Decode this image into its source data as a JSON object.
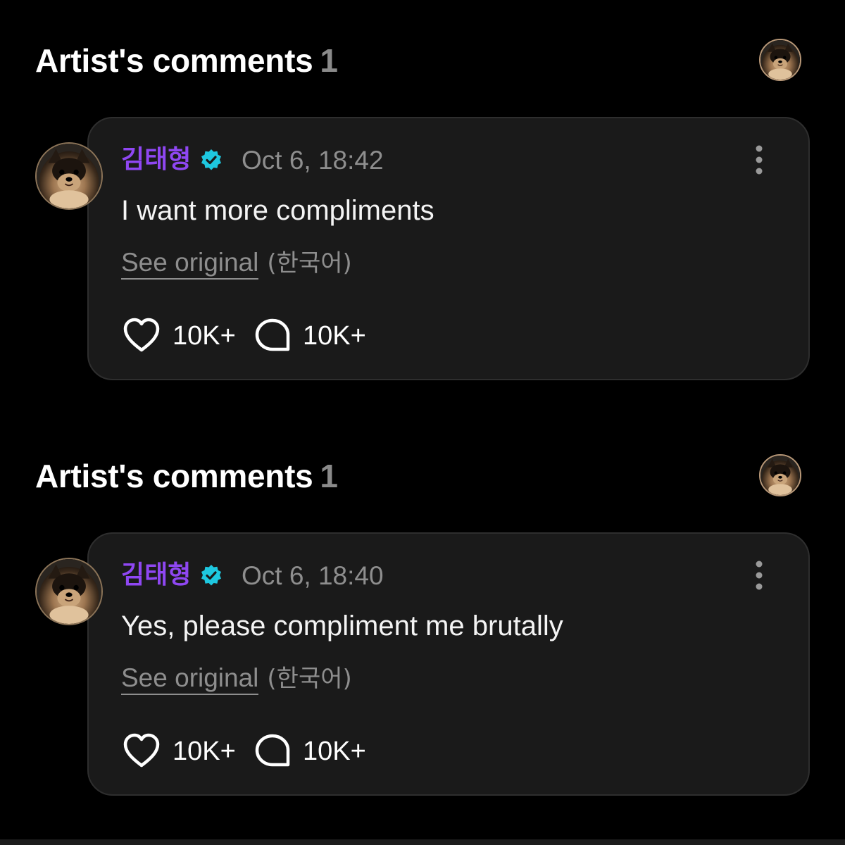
{
  "sections": [
    {
      "title": "Artist's comments",
      "count": "1",
      "comment": {
        "author": "김태형",
        "verified": true,
        "timestamp": "Oct 6, 18:42",
        "text": "I want more compliments",
        "see_original_label": "See original",
        "original_language": "(한국어)",
        "likes": "10K+",
        "replies": "10K+"
      }
    },
    {
      "title": "Artist's comments",
      "count": "1",
      "comment": {
        "author": "김태형",
        "verified": true,
        "timestamp": "Oct 6, 18:40",
        "text": "Yes, please compliment me brutally",
        "see_original_label": "See original",
        "original_language": "(한국어)",
        "likes": "10K+",
        "replies": "10K+"
      }
    }
  ],
  "icons": {
    "verified": "verified-badge-icon",
    "more": "more-vertical-icon",
    "like": "heart-icon",
    "reply": "comment-bubble-icon",
    "avatar": "pomeranian-avatar"
  },
  "colors": {
    "background": "#000000",
    "card": "#1a1a1a",
    "author": "#8f47f2",
    "verified": "#1ec8e0",
    "muted": "#8e8e8e"
  }
}
